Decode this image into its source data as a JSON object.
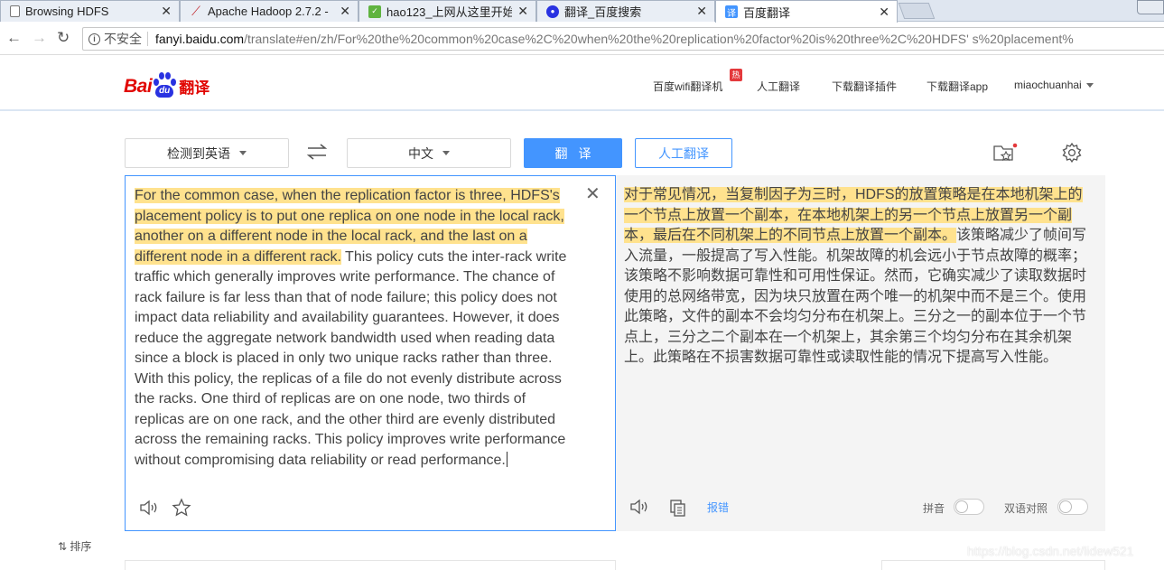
{
  "browser": {
    "tabs": [
      {
        "label": "Browsing HDFS",
        "icon": "page-icon",
        "active": false
      },
      {
        "label": "Apache Hadoop 2.7.2 -",
        "icon": "feather-icon",
        "active": false
      },
      {
        "label": "hao123_上网从这里开始",
        "icon": "hao123-icon",
        "active": false
      },
      {
        "label": "翻译_百度搜索",
        "icon": "baidu-paw-icon",
        "active": false
      },
      {
        "label": "百度翻译",
        "icon": "fanyi-icon",
        "active": true
      }
    ],
    "tab_fanyi_glyph": "译",
    "address": {
      "security": "不安全",
      "host": "fanyi.baidu.com",
      "path": "/translate#en/zh/For%20the%20common%20case%2C%20when%20the%20replication%20factor%20is%20three%2C%20HDFS'  s%20placement%"
    }
  },
  "header": {
    "logo": {
      "bai": "Bai",
      "du": "du",
      "fanyi": "翻译"
    },
    "nav": {
      "wifi": "百度wifi翻译机",
      "hot": "热",
      "human": "人工翻译",
      "plugin": "下载翻译插件",
      "app": "下载翻译app",
      "user": "miaochuanhai"
    }
  },
  "toolbar": {
    "source_lang": "检测到英语",
    "target_lang": "中文",
    "translate_label": "翻译",
    "human_label": "人工翻译"
  },
  "source": {
    "highlight": "For the common case, when the replication factor is three, HDFS's placement policy is to put one replica on one node in the local rack, another on a different node in the local rack, and the last on a different node in a different rack.",
    "rest": " This policy cuts the inter-rack write traffic which generally improves write performance. The chance of rack failure is far less than that of node failure; this policy does not impact data reliability and availability guarantees. However, it does reduce the aggregate network bandwidth used when reading data since a block is placed in only two unique racks rather than three. With this policy, the replicas of a file do not evenly distribute across the racks. One third of replicas are on one node, two thirds of replicas are on one rack, and the other third are evenly distributed across the remaining racks. This policy improves write performance without compromising data reliability or read performance."
  },
  "target": {
    "highlight": "对于常见情况，当复制因子为三时，HDFS的放置策略是在本地机架上的一个节点上放置一个副本，在本地机架上的另一个节点上放置另一个副本，最后在不同机架上的不同节点上放置一个副本。",
    "rest": "该策略减少了帧间写入流量，一般提高了写入性能。机架故障的机会远小于节点故障的概率；该策略不影响数据可靠性和可用性保证。然而，它确实减少了读取数据时使用的总网络带宽，因为块只放置在两个唯一的机架中而不是三个。使用此策略，文件的副本不会均匀分布在机架上。三分之一的副本位于一个节点上，三分之二个副本在一个机架上，其余第三个均匀分布在其余机架上。此策略在不损害数据可靠性或读取性能的情况下提高写入性能。",
    "feedback": "报错",
    "pinyin_label": "拼音",
    "bilingual_label": "双语对照"
  },
  "bottom": {
    "sort_label": "排序",
    "watermark": "https://blog.csdn.net/lidew521"
  },
  "colors": {
    "baidu_red": "#e10602",
    "baidu_blue": "#2932e1",
    "accent_blue": "#4395ff",
    "highlight": "#ffe28e"
  }
}
